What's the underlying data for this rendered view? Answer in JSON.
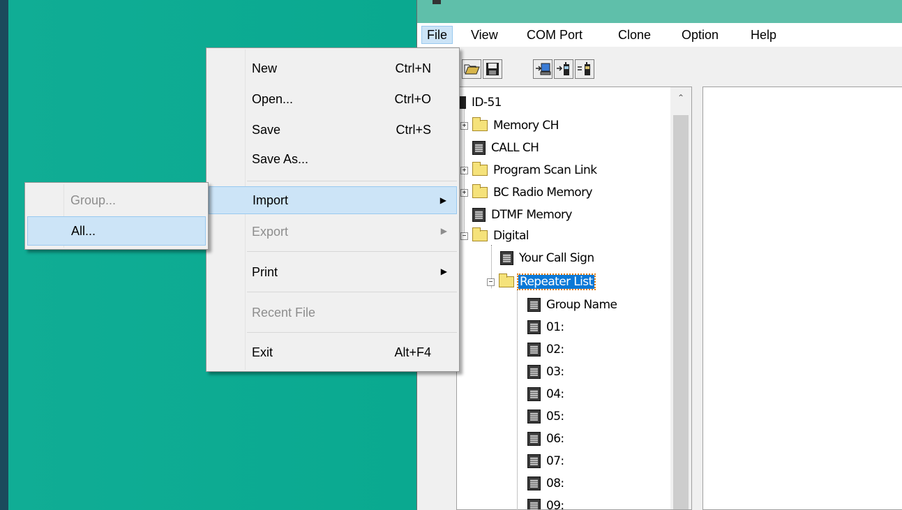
{
  "menubar": [
    "File",
    "View",
    "COM Port",
    "Clone",
    "Option",
    "Help"
  ],
  "file_menu": {
    "items": [
      {
        "label": "New",
        "shortcut": "Ctrl+N"
      },
      {
        "label": "Open...",
        "shortcut": "Ctrl+O"
      },
      {
        "label": "Save",
        "shortcut": "Ctrl+S"
      },
      {
        "label": "Save As...",
        "shortcut": ""
      },
      {
        "label": "Import",
        "shortcut": ""
      },
      {
        "label": "Export",
        "shortcut": ""
      },
      {
        "label": "Print",
        "shortcut": ""
      },
      {
        "label": "Recent File",
        "shortcut": ""
      },
      {
        "label": "Exit",
        "shortcut": "Alt+F4"
      }
    ]
  },
  "import_submenu": {
    "items": [
      {
        "label": "Group..."
      },
      {
        "label": "All..."
      }
    ]
  },
  "tree": {
    "root": "ID-51",
    "nodes": [
      "Memory CH",
      "CALL CH",
      "Program Scan Link",
      "BC Radio Memory",
      "DTMF Memory",
      "Digital"
    ],
    "digital_children": [
      "Your Call Sign",
      "Repeater List"
    ],
    "repeater_children": [
      "Group Name",
      "01:",
      "02:",
      "03:",
      "04:",
      "05:",
      "06:",
      "07:",
      "08:",
      "09:"
    ]
  },
  "expander_symbols": {
    "collapsed": "+",
    "expanded": "−"
  },
  "icons": [
    "open-folder-icon",
    "save-disk-icon",
    "read-from-radio-icon",
    "write-to-radio-icon",
    "clone-radio-icon"
  ],
  "colors": {
    "desktop": "#0aa990",
    "titlebar": "#5fbfaa",
    "menu_highlight": "#cce4f7",
    "selection": "#0a78d7"
  }
}
